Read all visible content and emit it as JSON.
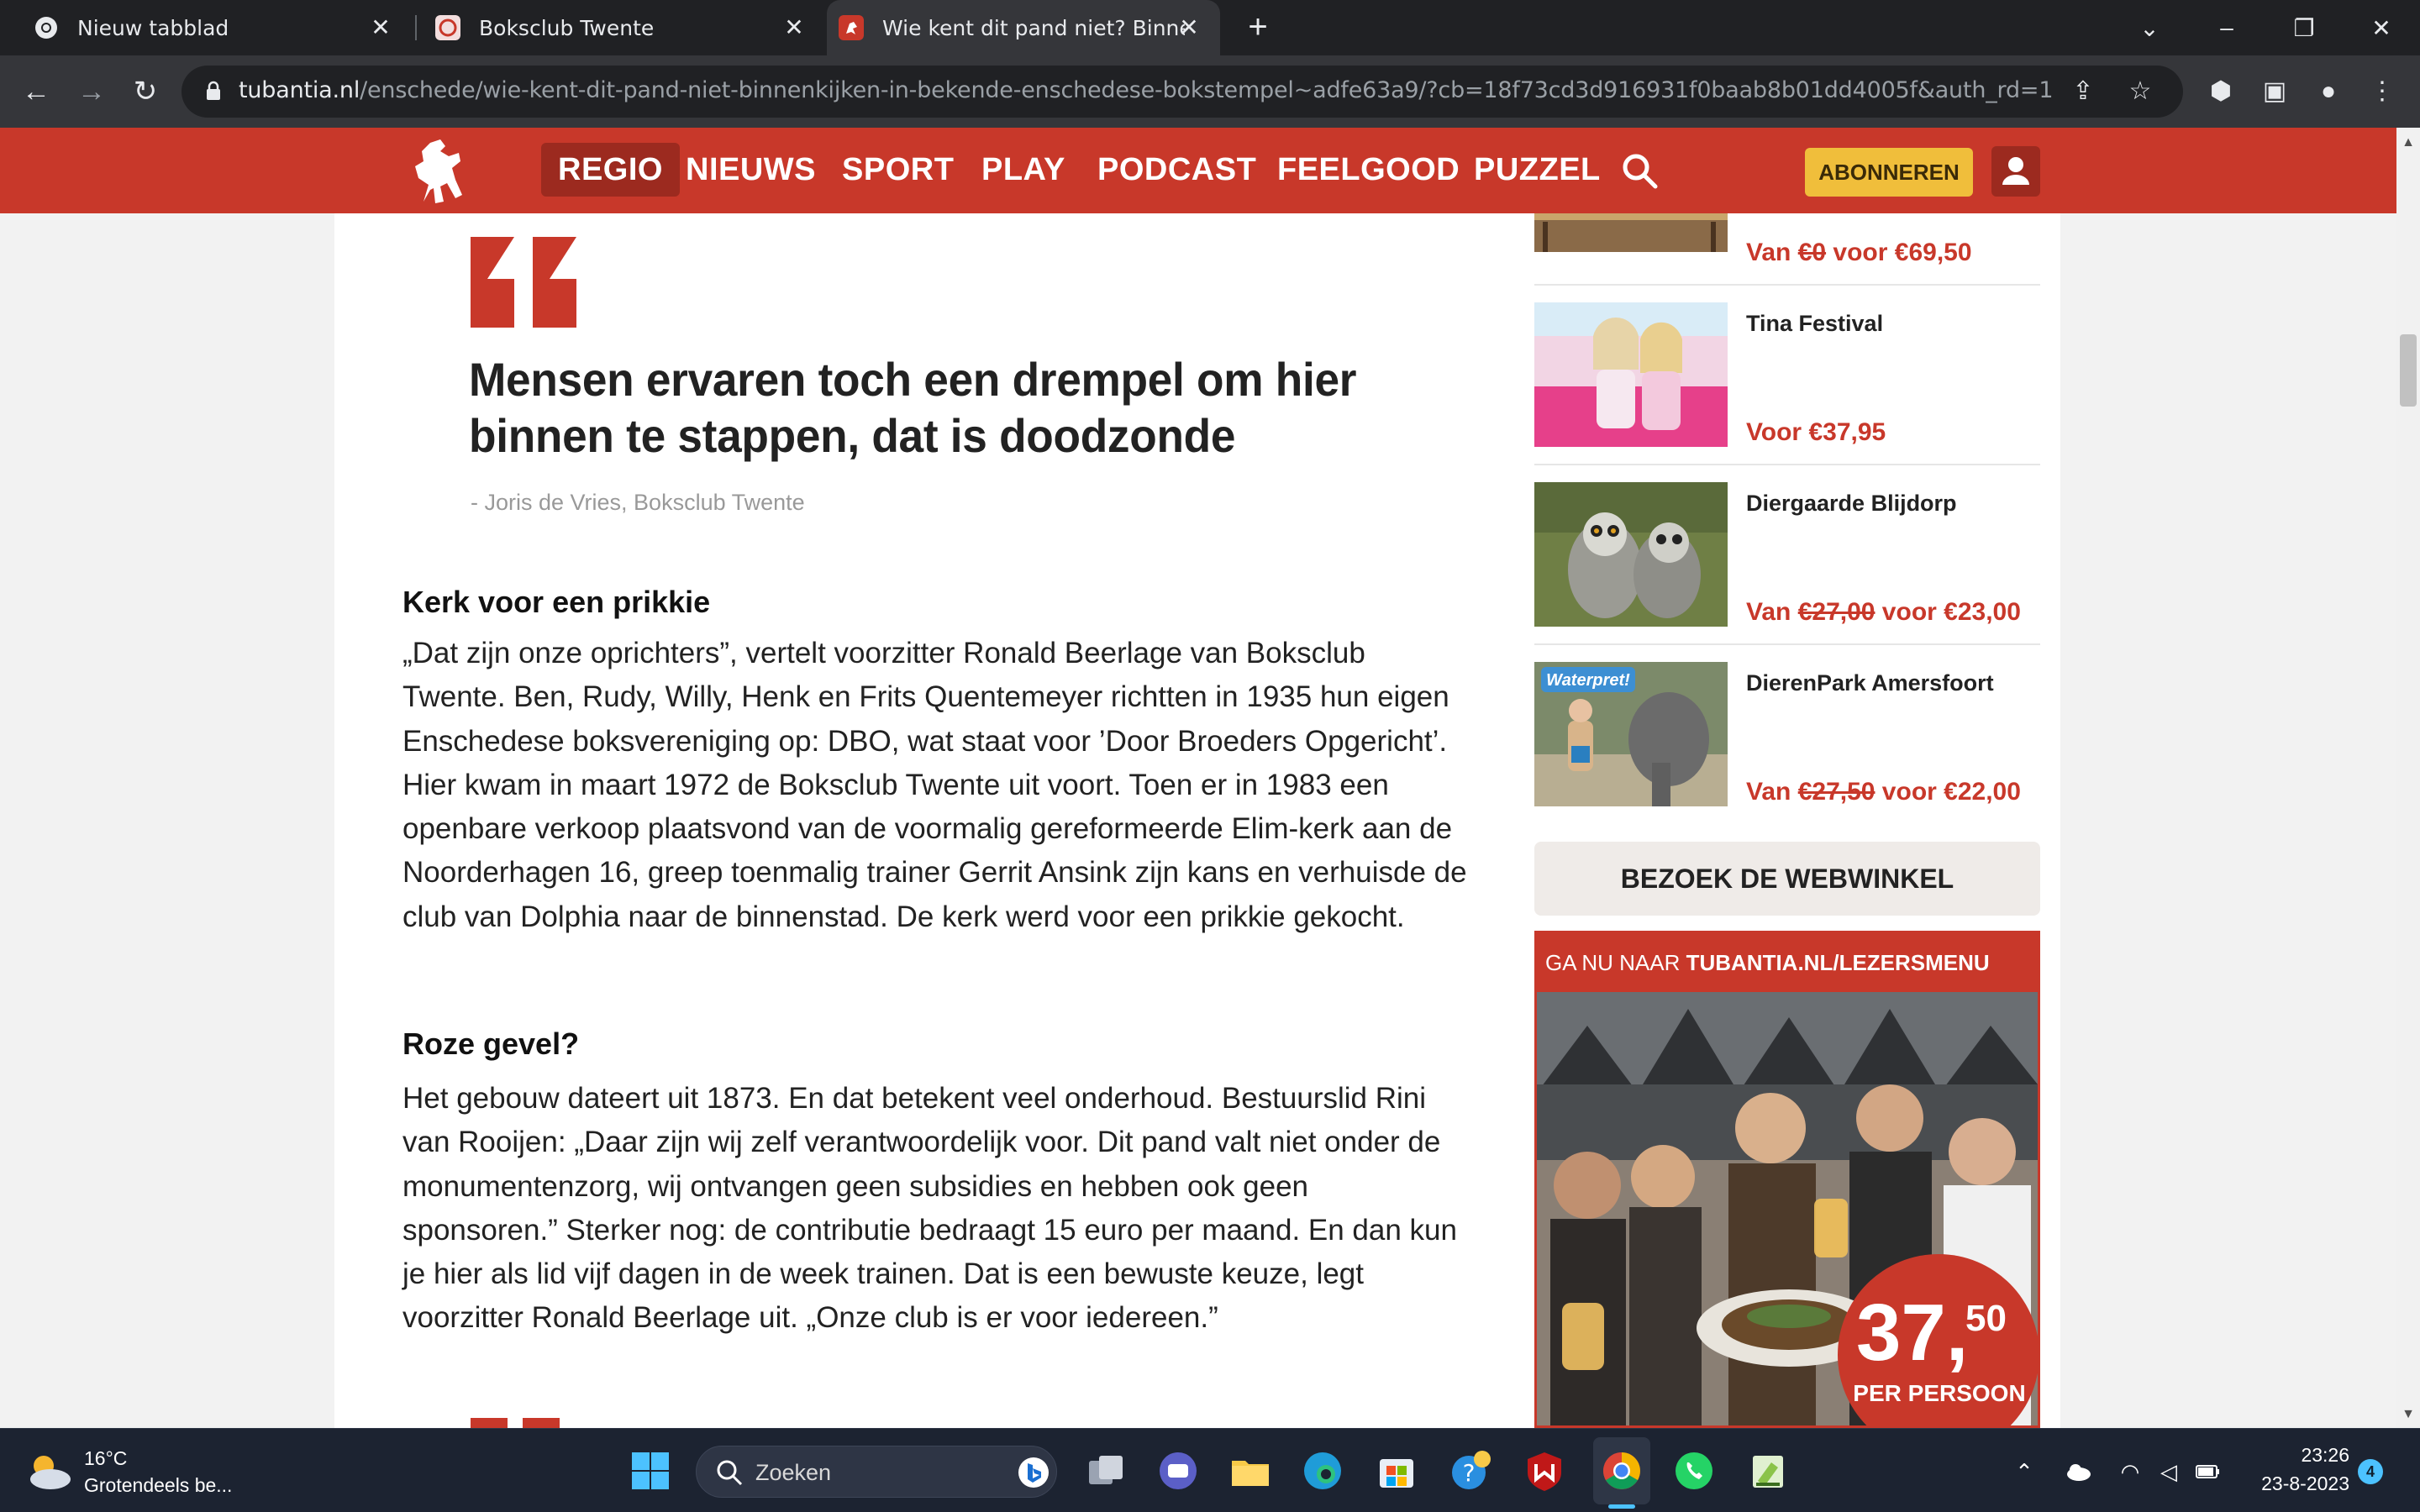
{
  "browser": {
    "tabs": [
      {
        "label": "Nieuw tabblad"
      },
      {
        "label": "Boksclub Twente"
      },
      {
        "label": "Wie kent dit pand niet? Binnenkijken"
      }
    ],
    "url_host": "tubantia.nl",
    "url_path": "/enschede/wie-kent-dit-pand-niet-binnenkijken-in-bekende-enschedese-bokstempel~adfe63a9/?cb=18f73cd3d916931f0baab8b01dd4005f&auth_rd=1"
  },
  "site": {
    "nav": [
      "REGIO",
      "NIEUWS",
      "SPORT",
      "PLAY",
      "PODCAST",
      "FEELGOOD",
      "PUZZEL"
    ],
    "subscribe_label": "ABONNEREN",
    "brand_color": "#c8382a",
    "subscribe_color": "#f0be3b"
  },
  "article": {
    "pullquote": "Mensen ervaren toch een drempel om hier binnen te stappen, dat is doodzonde",
    "quote_author": "- Joris de Vries, Boksclub Twente",
    "sections": [
      {
        "heading": "Kerk voor een prikkie",
        "body": "„Dat zijn onze oprichters”, vertelt voorzitter Ronald Beerlage van Boksclub Twente. Ben, Rudy, Willy, Henk en Frits Quentemeyer richtten in 1935 hun eigen Enschedese boksvereniging op: DBO, wat staat voor ’Door Broeders Opgericht’. Hier kwam in maart 1972 de Boksclub Twente uit voort. Toen er in 1983 een openbare verkoop plaatsvond van de voormalig gereformeerde Elim-kerk aan de Noorderhagen 16, greep toenmalig trainer Gerrit Ansink zijn kans en verhuisde de club van Dolphia naar de binnenstad. De kerk werd voor een prikkie gekocht."
      },
      {
        "heading": "Roze gevel?",
        "body": "Het gebouw dateert uit 1873. En dat betekent veel onderhoud. Bestuurslid Rini van Rooijen: „Daar zijn wij zelf verantwoordelijk voor. Dit pand valt niet onder de monumentenzorg, wij ontvangen geen subsidies en hebben ook geen sponsoren.” Sterker nog: de contributie bedraagt 15 euro per maand. En dan kun je hier als lid vijf dagen in de week trainen. Dat is een bewuste keuze, legt voorzitter Ronald Beerlage uit. „Onze club is er voor iedereen.”"
      }
    ]
  },
  "sidebar": {
    "items": [
      {
        "title": "",
        "price_prefix": "Van ",
        "price_old": "€0",
        "price_mid": " voor ",
        "price_new": "€69,50"
      },
      {
        "title": "Tina Festival",
        "price_prefix": "Voor ",
        "price_old": "",
        "price_mid": "",
        "price_new": "€37,95"
      },
      {
        "title": "Diergaarde Blijdorp",
        "price_prefix": "Van ",
        "price_old": "€27,00",
        "price_mid": " voor ",
        "price_new": "€23,00"
      },
      {
        "title": "DierenPark Amersfoort",
        "price_prefix": "Van ",
        "price_old": "€27,50",
        "price_mid": " voor ",
        "price_new": "€22,00"
      }
    ],
    "thumb_badge": "Waterpret!",
    "webshop_label": "BEZOEK DE WEBWINKEL",
    "ad": {
      "head_prefix": "GA NU NAAR ",
      "head_strong": "TUBANTIA.NL/LEZERSMENU",
      "price_main": "37,",
      "price_cents": "50",
      "price_sub": "PER PERSOON"
    }
  },
  "taskbar": {
    "temp": "16°C",
    "weather": "Grotendeels be...",
    "search_label": "Zoeken",
    "time": "23:26",
    "date": "23-8-2023",
    "notifications": "4"
  }
}
